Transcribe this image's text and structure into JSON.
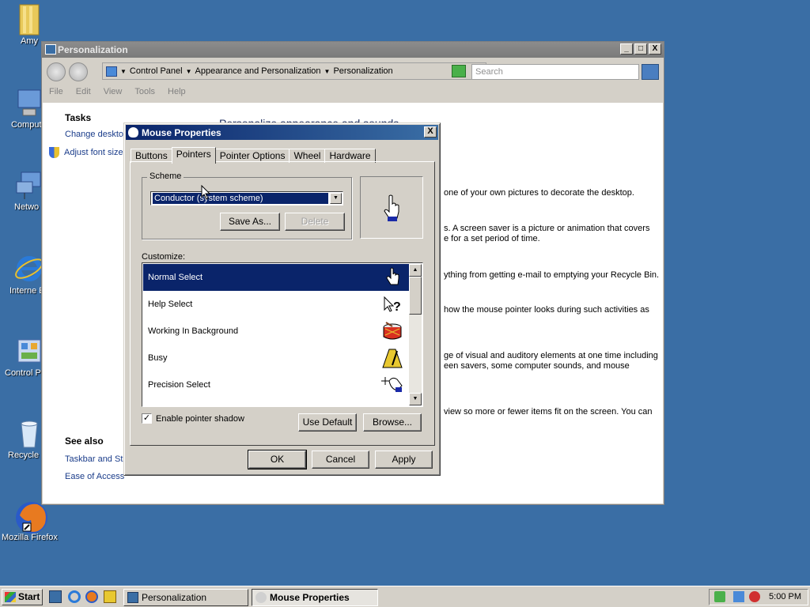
{
  "desktop": {
    "icons": [
      {
        "label": "Amy"
      },
      {
        "label": "Comput"
      },
      {
        "label": "Netwo"
      },
      {
        "label": "Interne Explore"
      },
      {
        "label": "Control P"
      },
      {
        "label": "Recycle"
      },
      {
        "label": "Mozilla Firefox"
      }
    ]
  },
  "personalization": {
    "title": "Personalization",
    "caption_buttons": {
      "minimize": "_",
      "maximize": "□",
      "close": "X"
    },
    "breadcrumb": [
      "Control Panel",
      "Appearance and Personalization",
      "Personalization"
    ],
    "search_placeholder": "Search",
    "menu": [
      "File",
      "Edit",
      "View",
      "Tools",
      "Help"
    ],
    "tasks_heading": "Tasks",
    "tasks": [
      "Change deskto",
      "Adjust font size"
    ],
    "see_also_heading": "See also",
    "see_also": [
      "Taskbar and St",
      "Ease of Access"
    ],
    "main_heading": "Personalize appearance and sounds",
    "snippets": [
      "one of your own pictures to decorate the desktop.",
      "s. A screen saver is a picture or animation that covers",
      "e for a set period of time.",
      "ything from getting e-mail to emptying your Recycle Bin.",
      "how the mouse pointer looks during such activities as",
      "ge of visual and auditory elements at one time including",
      "een savers, some computer sounds, and mouse",
      "view so more or fewer items fit on the screen. You can"
    ]
  },
  "mouse_properties": {
    "title": "Mouse Properties",
    "close": "X",
    "tabs": [
      "Buttons",
      "Pointers",
      "Pointer Options",
      "Wheel",
      "Hardware"
    ],
    "active_tab": "Pointers",
    "scheme_label": "Scheme",
    "scheme_value": "Conductor (system scheme)",
    "save_as": "Save As...",
    "delete": "Delete",
    "customize_label": "Customize:",
    "pointers": [
      {
        "name": "Normal Select",
        "icon": "hand-pointer-icon"
      },
      {
        "name": "Help Select",
        "icon": "help-pointer-icon"
      },
      {
        "name": "Working In Background",
        "icon": "drum-icon"
      },
      {
        "name": "Busy",
        "icon": "metronome-icon"
      },
      {
        "name": "Precision Select",
        "icon": "precision-pointer-icon"
      }
    ],
    "selected_pointer": "Normal Select",
    "enable_shadow_label": "Enable pointer shadow",
    "enable_shadow_checked": true,
    "use_default": "Use Default",
    "browse": "Browse...",
    "ok": "OK",
    "cancel": "Cancel",
    "apply": "Apply"
  },
  "taskbar": {
    "start": "Start",
    "buttons": [
      "Personalization",
      "Mouse Properties"
    ],
    "active_button": "Mouse Properties",
    "clock": "5:00 PM"
  },
  "colors": {
    "desktop": "#3a6ea5",
    "selection": "#0a246a",
    "dialog_face": "#d4d0c8"
  }
}
